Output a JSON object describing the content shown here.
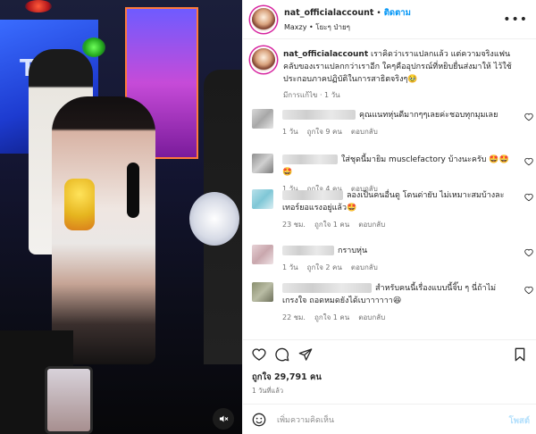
{
  "post": {
    "username": "nat_officialaccount",
    "follow_label": "ติดตาม",
    "location": "Maxzy • โยะๆ ป่ายๆ",
    "caption_text": "เราคิดว่าเราแปลกแล้ว แต่ความจริงแฟนคลับของเราแปลกกว่าเราอีก ใคๆคืออุปกรณ์ที่หยิบยื่นส่งมาให้ ไว้ใช้ประกอบภาคปฏิบัติในการสาธิตจริงๆ🥹",
    "caption_meta": "มีการแก้ไข · 1 วัน"
  },
  "comments": [
    {
      "text": "คุณแนทหุ่นดีมากๆๆเลยค่ะชอบทุกมุมเลย",
      "age": "1 วัน",
      "likes": "ถูกใจ 9 คน",
      "reply": "ตอบกลับ"
    },
    {
      "text": "ใส่ชุดนี้มายิม musclefactory บ้างนะครับ 🤩🤩🤩",
      "age": "1 วัน",
      "likes": "ถูกใจ 4 คน",
      "reply": "ตอบกลับ"
    },
    {
      "text": "ลองเป็นคนอื่นดู โดนด่ายับ ไม่เหมาะสมบ้างละ เทอร์ยอแรงอยู่แล้ว🤩",
      "age": "23 ชม.",
      "likes": "ถูกใจ 1 คน",
      "reply": "ตอบกลับ"
    },
    {
      "text": "กราบหุ่น",
      "age": "1 วัน",
      "likes": "ถูกใจ 2 คน",
      "reply": "ตอบกลับ"
    },
    {
      "text": "สำหรับคนนี้เรื่องแบบนี้จิ๊บ ๆ นี่ถ้าไม่เกรงใจ ถอดหมดยังได้เบาาาาาา😆",
      "age": "22 ชม.",
      "likes": "ถูกใจ 1 คน",
      "reply": "ตอบกลับ"
    }
  ],
  "stats": {
    "likes": "ถูกใจ 29,791 คน",
    "time": "1 วันที่แล้ว"
  },
  "composer": {
    "placeholder": "เพิ่มความคิดเห็น",
    "post_label": "โพสต์"
  },
  "colors": {
    "accent": "#0095f6",
    "like_heart": "#262626"
  }
}
